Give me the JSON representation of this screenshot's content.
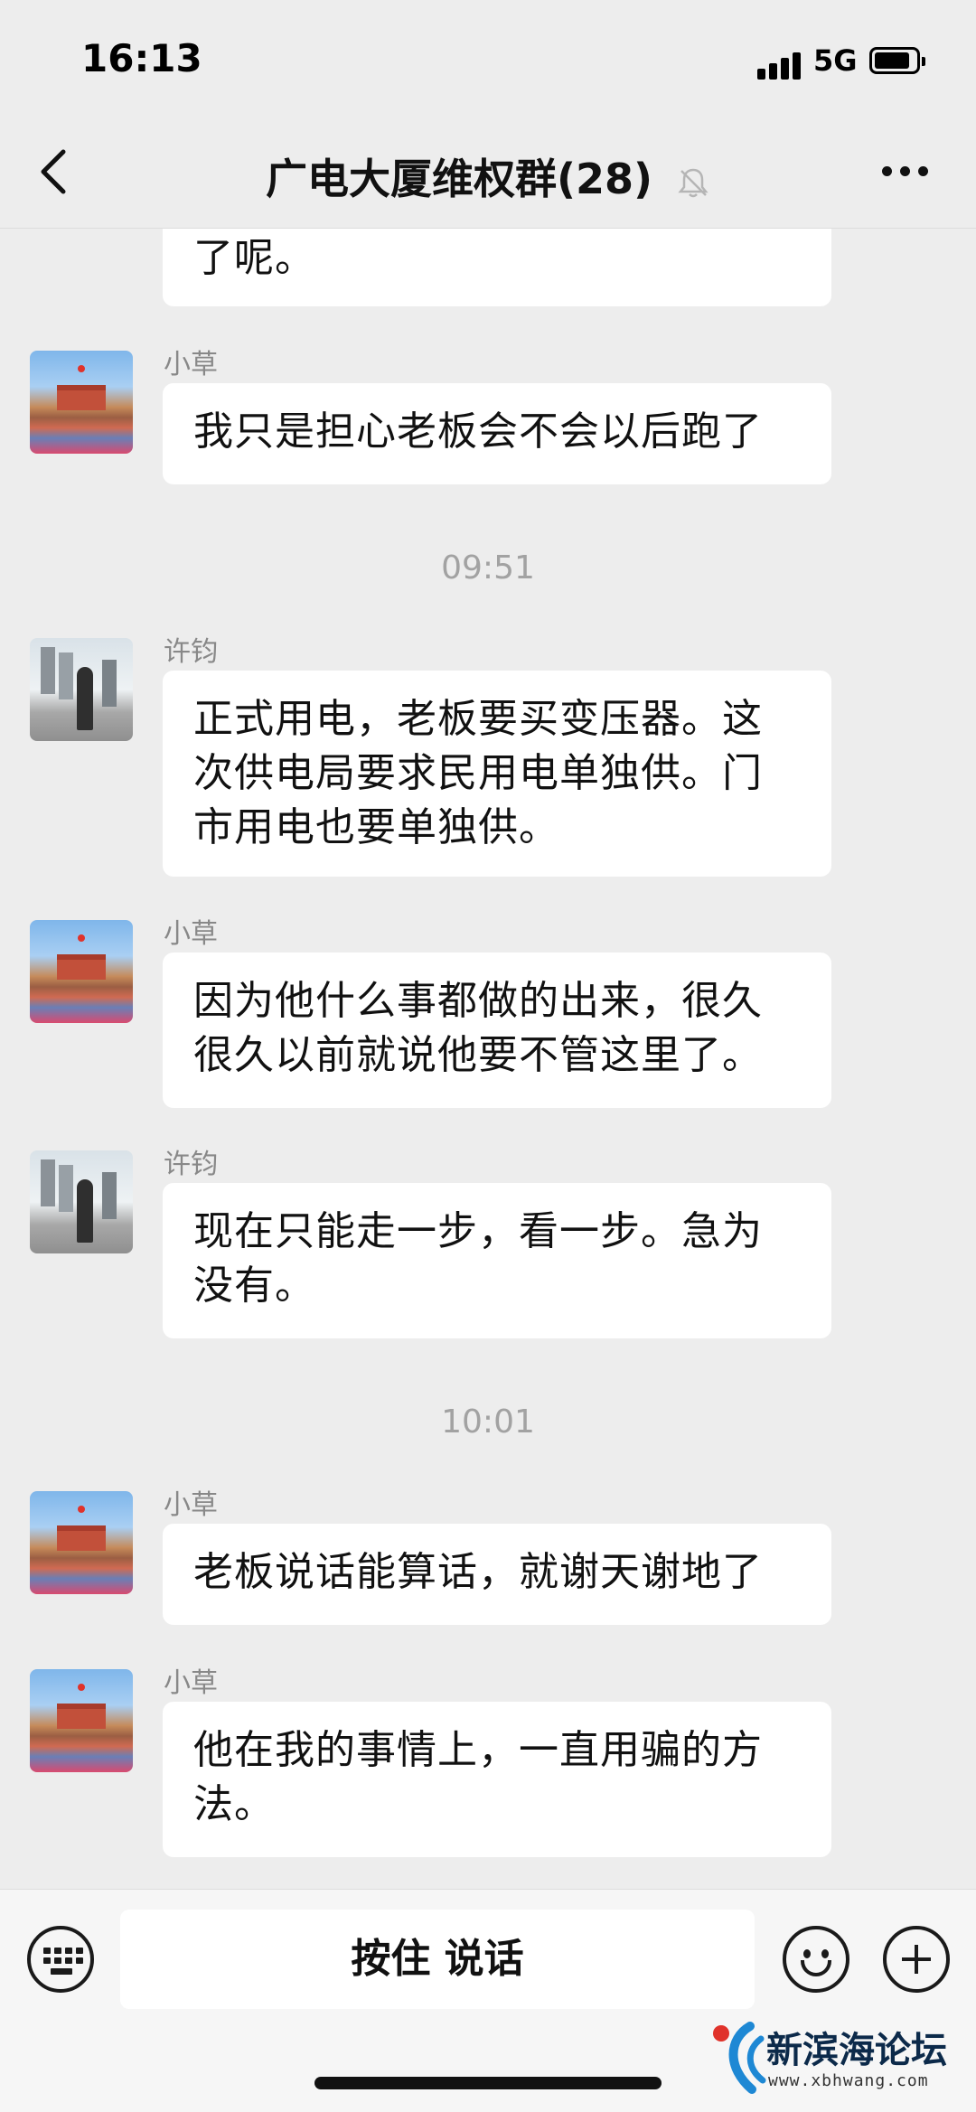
{
  "status_bar": {
    "time": "16:13",
    "network": "5G"
  },
  "header": {
    "title": "广电大厦维权群(28)"
  },
  "timestamps": [
    "09:51",
    "10:01"
  ],
  "messages": [
    {
      "sender": "",
      "text": "了呢。"
    },
    {
      "sender": "小草",
      "text": "我只是担心老板会不会以后跑了"
    },
    {
      "sender": "许钧",
      "text": "正式用电，老板要买变压器。这次供电局要求民用电单独供。门市用电也要单独供。"
    },
    {
      "sender": "小草",
      "text": "因为他什么事都做的出来，很久很久以前就说他要不管这里了。"
    },
    {
      "sender": "许钧",
      "text": "现在只能走一步，看一步。急为没有。"
    },
    {
      "sender": "小草",
      "text": "老板说话能算话，就谢天谢地了"
    },
    {
      "sender": "小草",
      "text": "他在我的事情上，一直用骗的方法。"
    }
  ],
  "input_bar": {
    "talk_label": "按住 说话"
  },
  "watermark": {
    "title": "新滨海论坛",
    "url": "www.xbhwang.com"
  },
  "icons": {
    "back": "chevron-left-icon",
    "mute": "bell-muted-icon",
    "more": "more-dots-icon",
    "keyboard": "keyboard-icon",
    "emoji": "emoji-icon",
    "plus": "plus-icon"
  }
}
